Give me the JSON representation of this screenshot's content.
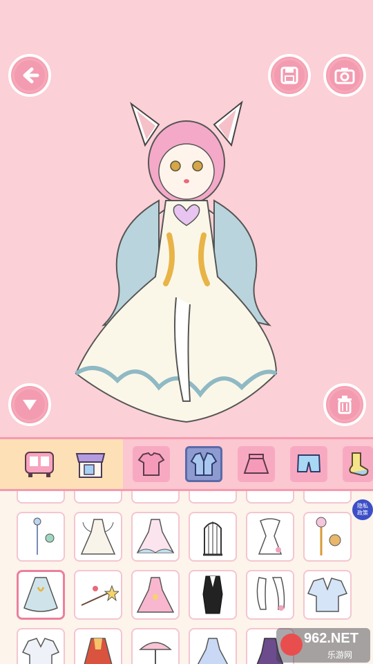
{
  "icons": {
    "back": "arrow-left-icon",
    "save": "floppy-disk-icon",
    "camera": "camera-icon",
    "down": "triangle-down-icon",
    "delete": "trash-icon"
  },
  "colors": {
    "background": "#fbd0d6",
    "button": "#f7a8b8",
    "tabbar": "#fbc7d0",
    "grid_bg": "#fdf4ec",
    "selected_tab": "#8e9bd1"
  },
  "tabs": [
    {
      "name": "wardrobe-tab",
      "icon": "wardrobe-icon"
    },
    {
      "name": "shop-tab",
      "icon": "shop-icon"
    },
    {
      "name": "tops-tab",
      "icon": "tshirt-icon"
    },
    {
      "name": "outerwear-tab",
      "icon": "jacket-icon",
      "selected": true
    },
    {
      "name": "skirts-tab",
      "icon": "skirt-icon"
    },
    {
      "name": "pants-tab",
      "icon": "shorts-icon"
    },
    {
      "name": "shoes-tab",
      "icon": "sock-icon"
    }
  ],
  "privacy_badge": "隐私\n政策",
  "watermark": {
    "brand": "962.NET",
    "sub": "乐游网"
  }
}
